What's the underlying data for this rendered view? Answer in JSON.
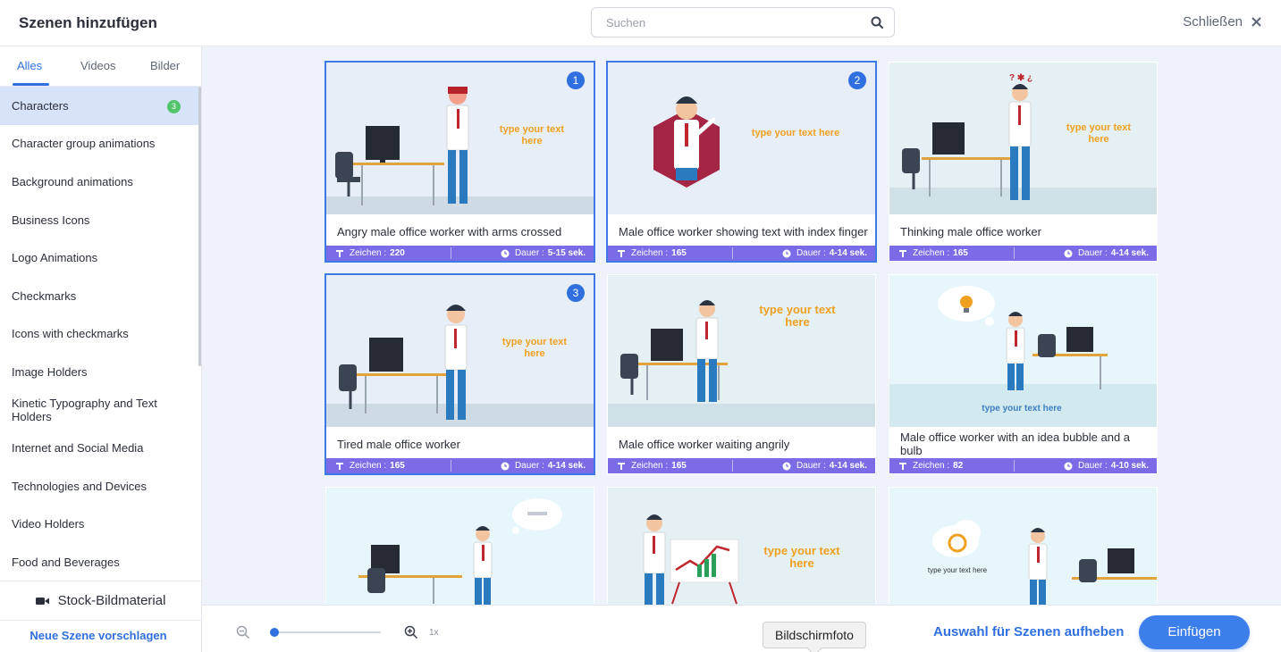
{
  "header": {
    "title": "Szenen hinzufügen",
    "search_placeholder": "Suchen",
    "close_label": "Schließen"
  },
  "tabs": [
    "Alles",
    "Videos",
    "Bilder"
  ],
  "categories": [
    {
      "label": "Characters",
      "badge": "3"
    },
    {
      "label": "Character group animations"
    },
    {
      "label": "Background animations"
    },
    {
      "label": "Business Icons"
    },
    {
      "label": "Logo Animations"
    },
    {
      "label": "Checkmarks"
    },
    {
      "label": "Icons with checkmarks"
    },
    {
      "label": "Image Holders"
    },
    {
      "label": "Kinetic Typography and Text Holders"
    },
    {
      "label": "Internet and Social Media"
    },
    {
      "label": "Technologies and Devices"
    },
    {
      "label": "Video Holders"
    },
    {
      "label": "Food and Beverages"
    }
  ],
  "stock_label": "Stock-Bildmaterial",
  "suggest_label": "Neue Szene vorschlagen",
  "meta_labels": {
    "chars": "Zeichen :",
    "duration": "Dauer :"
  },
  "placeholder_text": "type your text here",
  "placeholder_line1": "type your text",
  "placeholder_line2": "here",
  "scenes": [
    {
      "caption": "Angry male office worker with arms crossed",
      "chars": "220",
      "duration": "5-15 sek.",
      "selected": true,
      "order": "1"
    },
    {
      "caption": "Male office worker showing text with index finger",
      "chars": "165",
      "duration": "4-14 sek.",
      "selected": true,
      "order": "2"
    },
    {
      "caption": "Thinking male office worker",
      "chars": "165",
      "duration": "4-14 sek."
    },
    {
      "caption": "Tired male office worker",
      "chars": "165",
      "duration": "4-14 sek.",
      "selected": true,
      "order": "3"
    },
    {
      "caption": "Male office worker waiting angrily",
      "chars": "165",
      "duration": "4-14 sek."
    },
    {
      "caption": "Male office worker with an idea bubble and a bulb",
      "chars": "82",
      "duration": "4-10 sek."
    }
  ],
  "zoom": {
    "level_label": "1x",
    "value": 0
  },
  "tooltip": "Bildschirmfoto",
  "deselect_label": "Auswahl für Szenen aufheben",
  "insert_label": "Einfügen",
  "colors": {
    "accent": "#2f6fe0",
    "meta_bar": "#7a6ce6",
    "badge": "#52c46b",
    "placeholder_text": "#f0a020"
  }
}
